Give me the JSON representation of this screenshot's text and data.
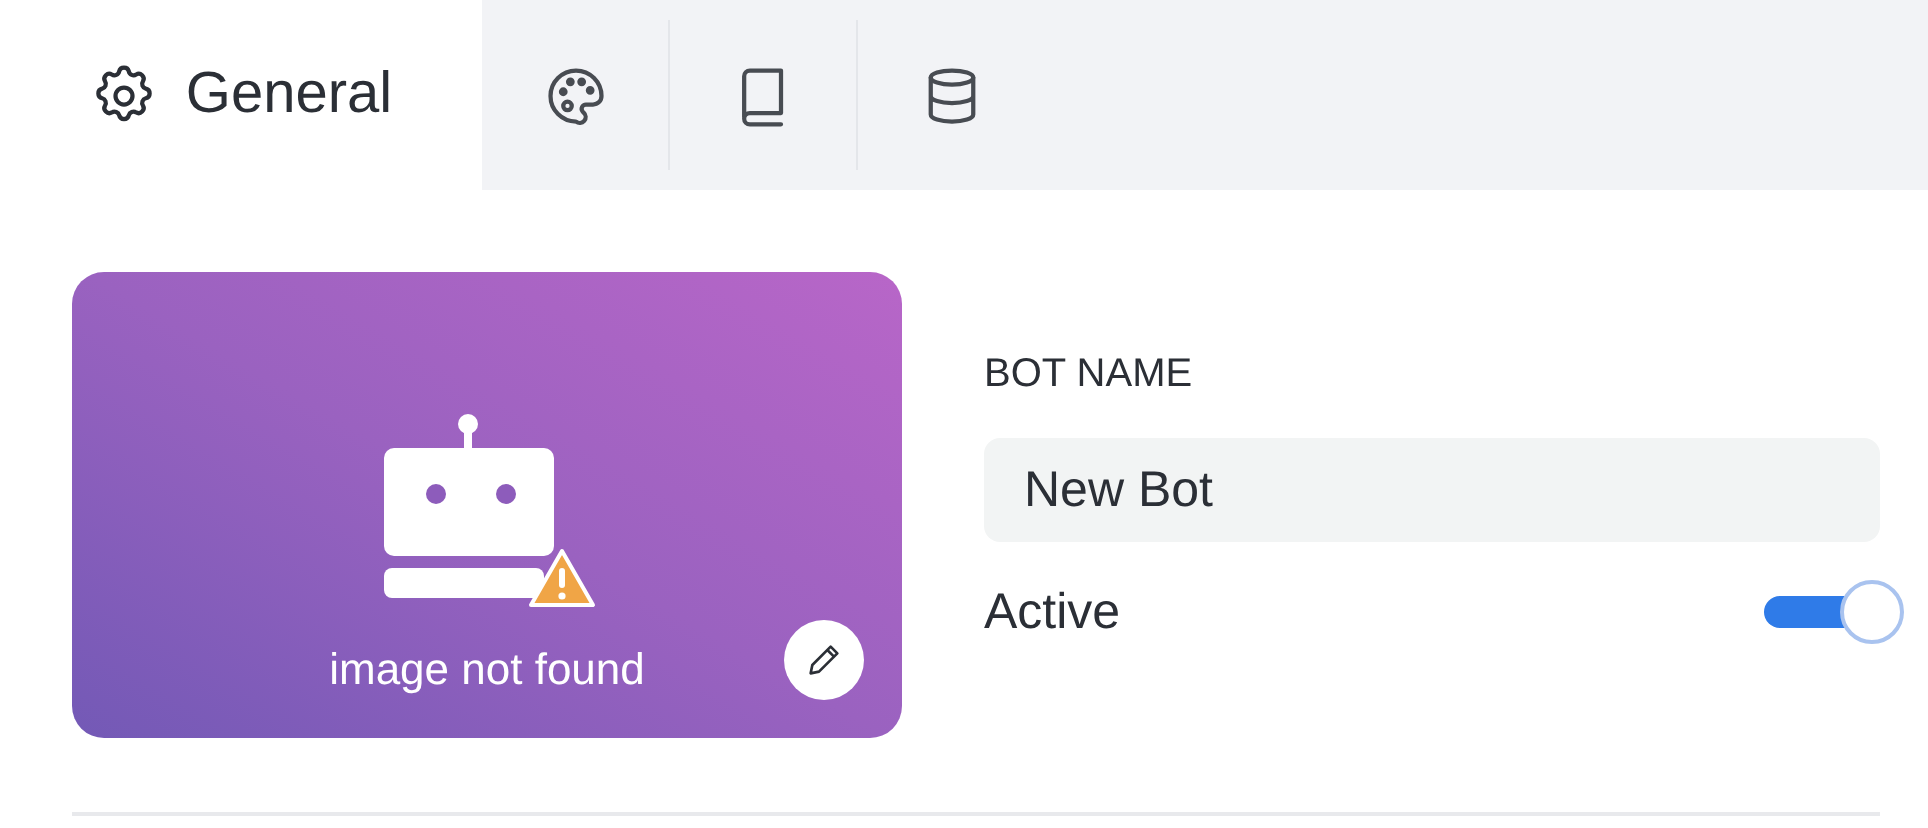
{
  "tabs": [
    {
      "kind": "gear",
      "label": "General",
      "selected": true
    },
    {
      "kind": "palette",
      "selected": false
    },
    {
      "kind": "book",
      "selected": false
    },
    {
      "kind": "database",
      "selected": false
    }
  ],
  "avatar": {
    "caption": "image not found",
    "warning": true
  },
  "bot_name": {
    "label": "BOT NAME",
    "value": "New Bot"
  },
  "active": {
    "label": "Active",
    "on": true
  }
}
